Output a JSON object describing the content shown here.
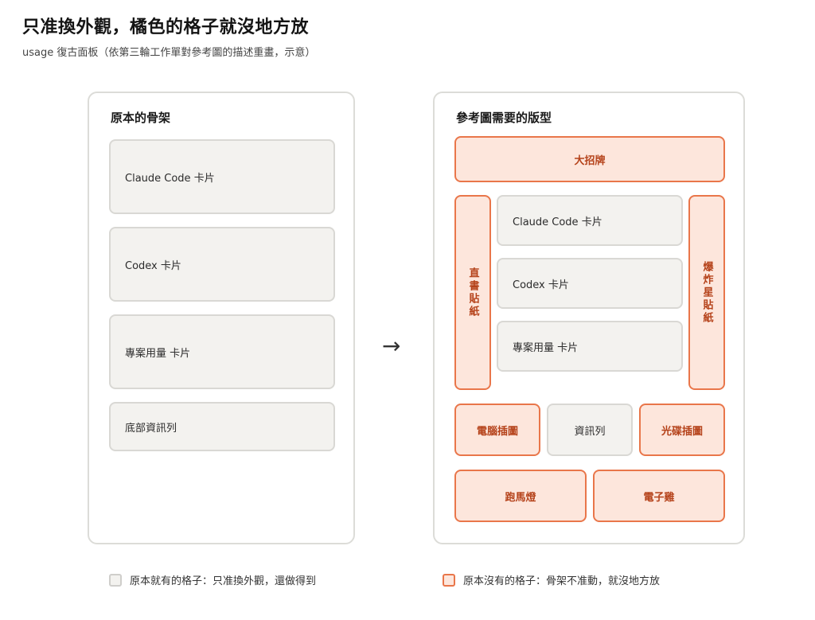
{
  "header": {
    "title": "只准換外觀，橘色的格子就沒地方放",
    "subtitle": "usage 復古面板（依第三輪工作單對參考圖的描述重畫，示意）"
  },
  "left_panel": {
    "title": "原本的骨架",
    "cards": [
      "Claude Code 卡片",
      "Codex 卡片",
      "專案用量 卡片",
      "底部資訊列"
    ]
  },
  "arrow": "→",
  "right_panel": {
    "title": "參考圖需要的版型",
    "banner": "大招牌",
    "left_sticker": "直書貼紙",
    "right_sticker": "爆炸星貼紙",
    "cards": [
      "Claude Code 卡片",
      "Codex 卡片",
      "專案用量 卡片"
    ],
    "pc_illustration": "電腦插圖",
    "info_bar": "資訊列",
    "disc_illustration": "光碟插圖",
    "marquee": "跑馬燈",
    "pet": "電子雞"
  },
  "legend": {
    "existing": "原本就有的格子：只准換外觀，還做得到",
    "missing": "原本沒有的格子：骨架不准動，就沒地方放"
  },
  "colors": {
    "gray_fill": "#f3f2ef",
    "gray_border": "#d9d8d4",
    "orange_fill": "#fde6dc",
    "orange_border": "#e9764a",
    "orange_text": "#b5421a"
  }
}
